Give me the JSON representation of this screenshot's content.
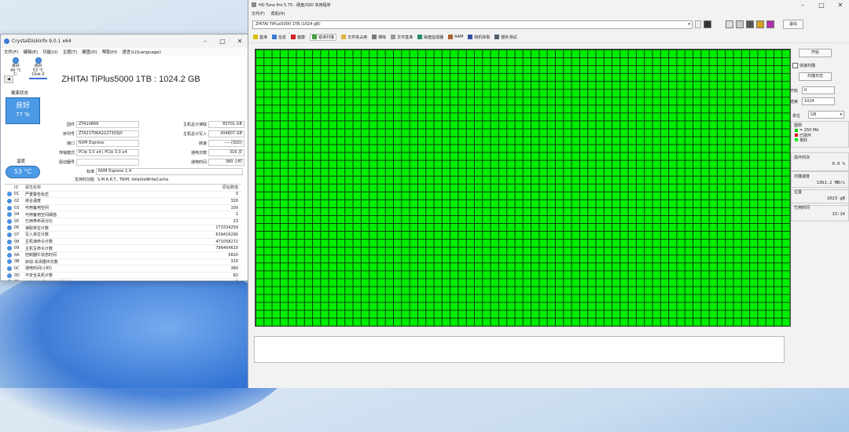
{
  "crystal": {
    "title": "CrystalDiskInfo 9.0.1 x64",
    "menu": [
      "文件(F)",
      "编辑(E)",
      "功能(U)",
      "主题(T)",
      "硬盘(D)",
      "帮助(H)",
      "语言(L)(Language)"
    ],
    "drives": [
      {
        "status": "良好",
        "temp": "49 °C",
        "label": "C:"
      },
      {
        "status": "良好",
        "temp": "53 °C",
        "label": "Disk 0"
      }
    ],
    "disk_title": "ZHITAI TiPlus5000 1TB : 1024.2 GB",
    "health_label": "健康状态",
    "health_status": "良好",
    "health_percent": "77 %",
    "temp_label": "温度",
    "temperature": "53 °C",
    "fields": {
      "firmware_label": "固件",
      "firmware": "ZTA10666",
      "serial_label": "序列号",
      "serial": "ZTA21T0KA2227303J0",
      "interface_label": "接口",
      "interface": "NVM Express",
      "transfer_label": "传输模式",
      "transfer": "PCIe 3.0 x4 | PCIe 3.0 x4",
      "driveletter_label": "驱动器号",
      "driveletter": "",
      "standard_label": "标准",
      "standard": "NVM Express 1.4",
      "features_label": "支持的功能",
      "features": "S.M.A.R.T., TRIM, VolatileWriteCache",
      "host_reads_label": "主机总计读取",
      "host_reads": "83701 GB",
      "host_writes_label": "主机总计写入",
      "host_writes": "304807 GB",
      "rotation_label": "转速",
      "rotation": "---- (SSD)",
      "power_count_label": "通电次数",
      "power_count": "316 次",
      "power_hours_label": "通电时间",
      "power_hours": "380 小时"
    },
    "table_headers": {
      "id": "ID",
      "name": "属性名称",
      "raw": "原始数值"
    },
    "attributes": [
      {
        "id": "01",
        "name": "严重警告标志",
        "raw": "0"
      },
      {
        "id": "02",
        "name": "综合温度",
        "raw": "326"
      },
      {
        "id": "03",
        "name": "可用备用空间",
        "raw": "100"
      },
      {
        "id": "04",
        "name": "可用备用空间阈值",
        "raw": "1"
      },
      {
        "id": "05",
        "name": "已用寿命百分比",
        "raw": "23"
      },
      {
        "id": "06",
        "name": "读取单位计数",
        "raw": "173334259"
      },
      {
        "id": "07",
        "name": "写入单位计数",
        "raw": "639416290"
      },
      {
        "id": "08",
        "name": "主机读命令计数",
        "raw": "471058272"
      },
      {
        "id": "09",
        "name": "主机写命令计数",
        "raw": "796464610"
      },
      {
        "id": "0A",
        "name": "控制器忙状态时间",
        "raw": "5820"
      },
      {
        "id": "0B",
        "name": "启动-关闭循环次数",
        "raw": "316"
      },
      {
        "id": "0C",
        "name": "通电时间(小时)",
        "raw": "380"
      },
      {
        "id": "0D",
        "name": "不安全关机计数",
        "raw": "82"
      },
      {
        "id": "0E",
        "name": "介质与数据完整性错误计数",
        "raw": "0"
      },
      {
        "id": "0F",
        "name": "错误日志项数",
        "raw": "14"
      }
    ]
  },
  "hdtune": {
    "title": "HD Tune Pro 5.75 - 硬盘/SSD 实用程序",
    "menu": [
      "文件(F)",
      "帮助(H)"
    ],
    "drive": "ZHITAI TiPlus5000 1TB (1024 gB)",
    "exit_label": "退出",
    "tabs": [
      "基准",
      "信息",
      "健康",
      "错误扫描",
      "文件夹占用",
      "擦除",
      "文件基准",
      "磁盘监视器",
      "AAM",
      "随机存取",
      "额外测试"
    ],
    "side": {
      "start_label": "开始",
      "quick_scan_label": "快速扫描",
      "scan_log_label": "扫描日志",
      "start_field_label": "开始",
      "start_value": "0",
      "end_field_label": "结束",
      "end_value": "1024",
      "unit_label": "单位",
      "unit_value": "GB",
      "legend_title": "图例",
      "legend": [
        {
          "label": "= 250 Mb",
          "color": "#00cc00"
        },
        {
          "label": "已损坏",
          "color": "#cc0000"
        },
        {
          "label": "良好",
          "color": "#00ee00"
        }
      ],
      "damaged_label": "损坏的块",
      "damaged_value": "0.0 %",
      "speed_label": "扫描速度",
      "speed_value": "1361.2 MB/s",
      "position_label": "位置",
      "position_value": "1023 gB",
      "elapsed_label": "已用时间",
      "elapsed_value": "13:14"
    }
  }
}
